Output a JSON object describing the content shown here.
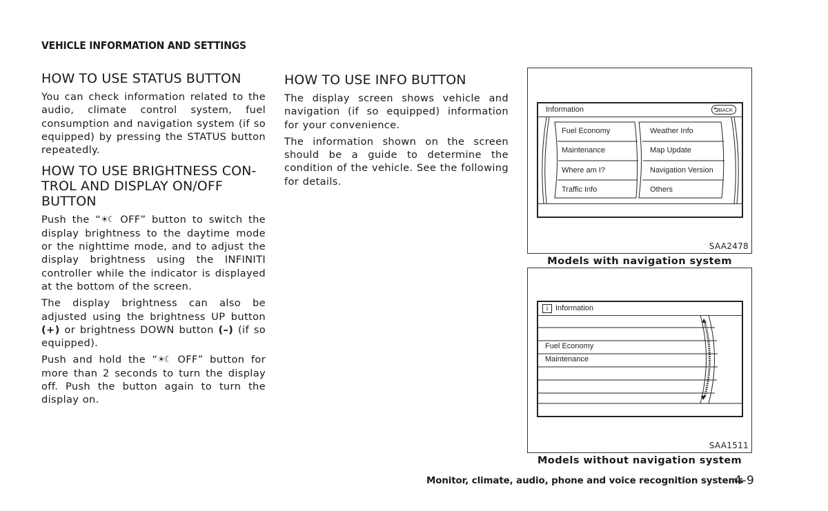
{
  "header": {
    "section_title": "VEHICLE INFORMATION AND SETTINGS"
  },
  "left_column": {
    "status": {
      "heading": "HOW TO USE STATUS BUTTON",
      "paragraphs": [
        "You can check information related to the audio, climate control system, fuel consumption and navigation system (if so equipped) by pressing the STATUS button repeatedly."
      ]
    },
    "brightness": {
      "heading_line1": "HOW TO USE BRIGHTNESS CON-",
      "heading_line2": "TROL AND DISPLAY ON/OFF BUTTON",
      "p1_pre": "Push the “",
      "symbol": "☀☾",
      "p1_post": " OFF” button to switch the display brightness to the daytime mode or the nighttime mode, and to adjust the display brightness using the INFINITI controller while the indicator is displayed at the bottom of the screen.",
      "p2_a": "The display brightness can also be adjusted using the brightness UP button ",
      "up_sign": "(+)",
      "p2_b": " or brightness DOWN button ",
      "down_sign": "(–)",
      "p2_c": " (if so equipped).",
      "p3_pre": "Push and hold the “",
      "p3_post": " OFF” button for more than 2 seconds to turn the display off. Push the button again to turn the display on."
    }
  },
  "middle_column": {
    "info": {
      "heading": "HOW TO USE INFO BUTTON",
      "paragraphs": [
        "The display screen shows vehicle and navigation (if so equipped) information for your convenience.",
        "The information shown on the screen should be a guide to determine the condition of the vehicle. See the following for details."
      ]
    }
  },
  "figures": {
    "with_nav": {
      "screen_title": "Information",
      "back_label": "BACK",
      "left_items": [
        "Fuel Economy",
        "Maintenance",
        "Where am I?",
        "Traffic Info"
      ],
      "right_items": [
        "Weather Info",
        "Map Update",
        "Navigation Version",
        "Others"
      ],
      "code": "SAA2478",
      "caption": "Models with navigation system"
    },
    "without_nav": {
      "screen_title": "Information",
      "info_icon": "i",
      "items": [
        "",
        "",
        "Fuel Economy",
        "Maintenance",
        "",
        "",
        ""
      ],
      "code": "SAA1511",
      "caption": "Models without navigation system"
    }
  },
  "footer": {
    "chapter": "Monitor, climate, audio, phone and voice recognition systems",
    "page": "4-9"
  }
}
